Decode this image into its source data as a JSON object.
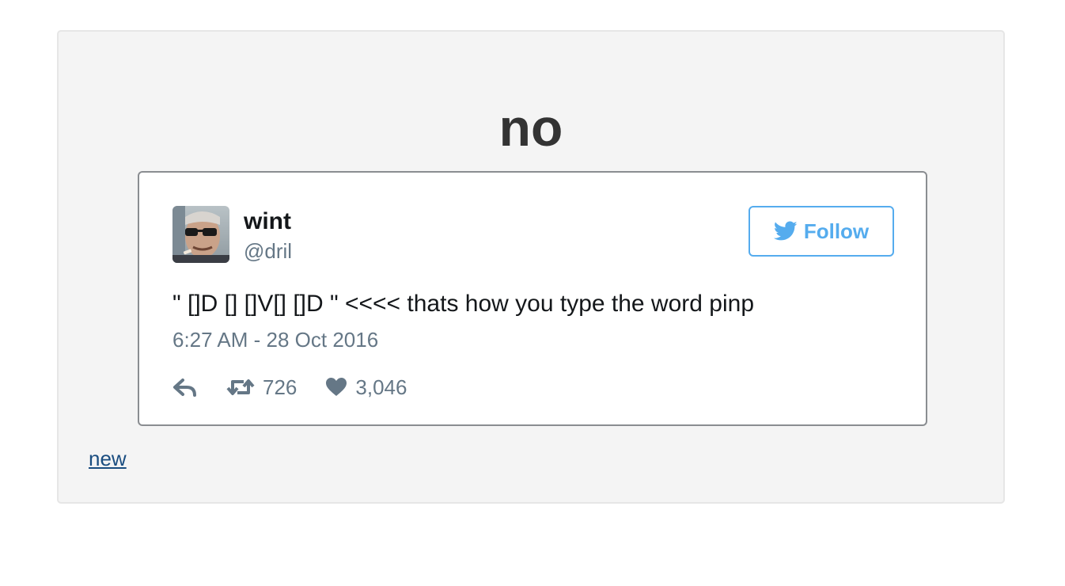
{
  "page": {
    "title": "no",
    "new_link": "new"
  },
  "tweet": {
    "author_name": "wint",
    "author_handle": "@dril",
    "follow_label": "Follow",
    "text": "\" []D [] []V[] []D \" <<<< thats how you type the word pinp",
    "timestamp": "6:27 AM - 28 Oct 2016",
    "retweet_count": "726",
    "like_count": "3,046"
  },
  "colors": {
    "panel_bg": "#f4f4f4",
    "twitter_blue": "#55acee",
    "meta_gray": "#657786",
    "link_blue": "#1a4d80"
  },
  "icons": {
    "reply": "reply-icon",
    "retweet": "retweet-icon",
    "like": "heart-icon",
    "follow": "twitter-bird-icon"
  }
}
